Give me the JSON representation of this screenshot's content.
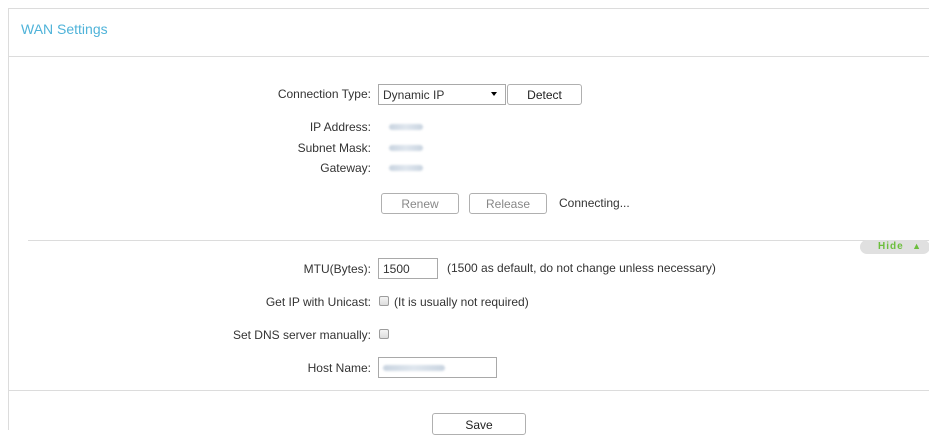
{
  "page": {
    "title": "WAN Settings"
  },
  "connection": {
    "type_label": "Connection Type:",
    "type_value": "Dynamic IP",
    "detect_label": "Detect",
    "ip_label": "IP Address:",
    "subnet_label": "Subnet Mask:",
    "gateway_label": "Gateway:",
    "renew_label": "Renew",
    "release_label": "Release",
    "status_text": "Connecting..."
  },
  "advanced": {
    "hide_label": "Hide",
    "mtu_label": "MTU(Bytes):",
    "mtu_value": "1500",
    "mtu_note": "(1500 as default, do not change unless necessary)",
    "unicast_label": "Get IP with Unicast:",
    "unicast_note": "(It is usually not required)",
    "unicast_checked": false,
    "dns_label": "Set DNS server manually:",
    "dns_checked": false,
    "host_label": "Host Name:"
  },
  "footer": {
    "save_label": "Save"
  },
  "colors": {
    "title": "#4fb3d9",
    "hide_text": "#6cbe3d",
    "divider": "#dcdcdc"
  },
  "icons": {
    "dropdown": "triangle-down",
    "collapse": "chevron-up"
  }
}
